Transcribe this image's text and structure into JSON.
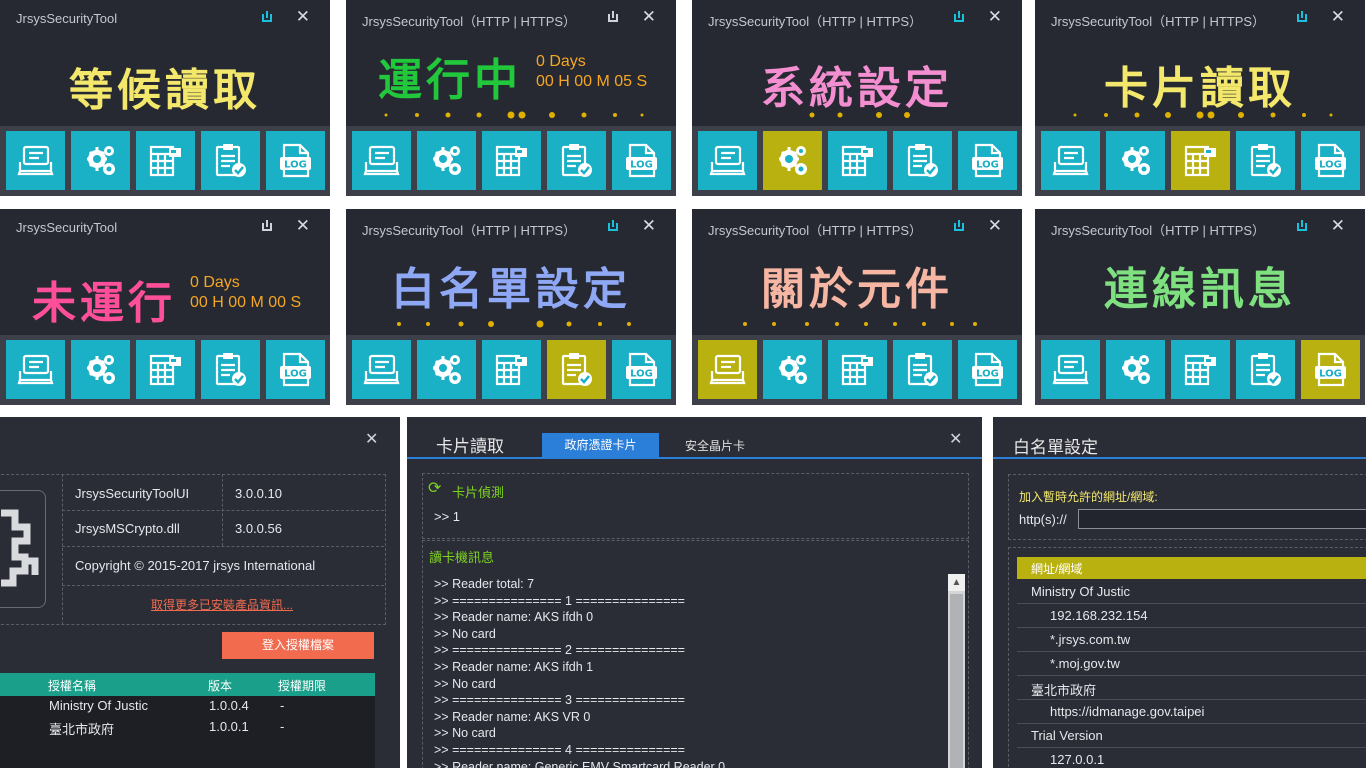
{
  "panels": [
    {
      "title": "JrsysSecurityTool",
      "main": "等候讀取",
      "color": "#f3e86b"
    },
    {
      "title": "JrsysSecurityTool（HTTP | HTTPS）",
      "main": "運行中",
      "color": "#22c83c",
      "days": "0 Days",
      "time": "00 H 00 M 05 S"
    },
    {
      "title": "JrsysSecurityTool（HTTP | HTTPS）",
      "main": "系統設定",
      "color": "#f38fd0"
    },
    {
      "title": "JrsysSecurityTool（HTTP | HTTPS）",
      "main": "卡片讀取",
      "color": "#f3e86b"
    },
    {
      "title": "JrsysSecurityTool",
      "main": "未運行",
      "color": "#ff4f9a",
      "days": "0 Days",
      "time": "00 H 00 M 00 S"
    },
    {
      "title": "JrsysSecurityTool（HTTP | HTTPS）",
      "main": "白名單設定",
      "color": "#8fa8f5"
    },
    {
      "title": "JrsysSecurityTool（HTTP | HTTPS）",
      "main": "關於元件",
      "color": "#f6b6a3"
    },
    {
      "title": "JrsysSecurityTool（HTTP | HTTPS）",
      "main": "連線訊息",
      "color": "#7fe07f"
    }
  ],
  "toolbar_icons": [
    "message-icon",
    "gears-icon",
    "calculator-card-icon",
    "clipboard-check-icon",
    "log-file-icon"
  ],
  "log_label": "LOG",
  "about": {
    "products": [
      {
        "name": "JrsysSecurityToolUI",
        "version": "3.0.0.10"
      },
      {
        "name": "JrsysMSCrypto.dll",
        "version": "3.0.0.56"
      }
    ],
    "copyright": "Copyright © 2015-2017 jrsys International",
    "more_link": "取得更多已安裝產品資訊...",
    "login_button": "登入授權檔案",
    "license_headers": [
      "授權名稱",
      "版本",
      "授權期限"
    ],
    "licenses": [
      {
        "name": "Ministry Of Justic",
        "version": "1.0.0.4",
        "expire": "-"
      },
      {
        "name": "臺北市政府",
        "version": "1.0.0.1",
        "expire": "-"
      }
    ]
  },
  "card": {
    "title": "卡片讀取",
    "tabs": [
      "政府憑證卡片",
      "安全晶片卡"
    ],
    "detect_label": "卡片偵測",
    "detect_value": ">> 1",
    "reader_info_label": "讀卡機訊息",
    "log_lines": [
      ">> Reader total: 7",
      ">> =============== 1 ===============",
      ">> Reader name: AKS ifdh 0",
      ">> No card",
      ">> =============== 2 ===============",
      ">> Reader name: AKS ifdh 1",
      ">> No card",
      ">> =============== 3 ===============",
      ">> Reader name: AKS VR 0",
      ">> No card",
      ">> =============== 4 ===============",
      ">> Reader name: Generic EMV Smartcard Reader 0"
    ]
  },
  "whitelist": {
    "title": "白名單設定",
    "add_label": "加入暫時允許的網址/網域:",
    "prefix": "http(s)://",
    "input_value": "",
    "header": "網址/網域",
    "items": [
      {
        "text": "Ministry Of Justic",
        "level": 0
      },
      {
        "text": "192.168.232.154",
        "level": 1
      },
      {
        "text": "*.jrsys.com.tw",
        "level": 1
      },
      {
        "text": "*.moj.gov.tw",
        "level": 1
      },
      {
        "text": "臺北市政府",
        "level": 0
      },
      {
        "text": "https://idmanage.gov.taipei",
        "level": 1
      },
      {
        "text": "Trial Version",
        "level": 0
      },
      {
        "text": "127.0.0.1",
        "level": 1
      }
    ]
  },
  "colors": {
    "accent": "#1ab0c6",
    "selected": "#b9b10f",
    "orange": "#f5a623",
    "green": "#7ed321",
    "teal_header": "#1aa08a",
    "login": "#f26b4f",
    "tab_blue": "#2b7fd9"
  }
}
